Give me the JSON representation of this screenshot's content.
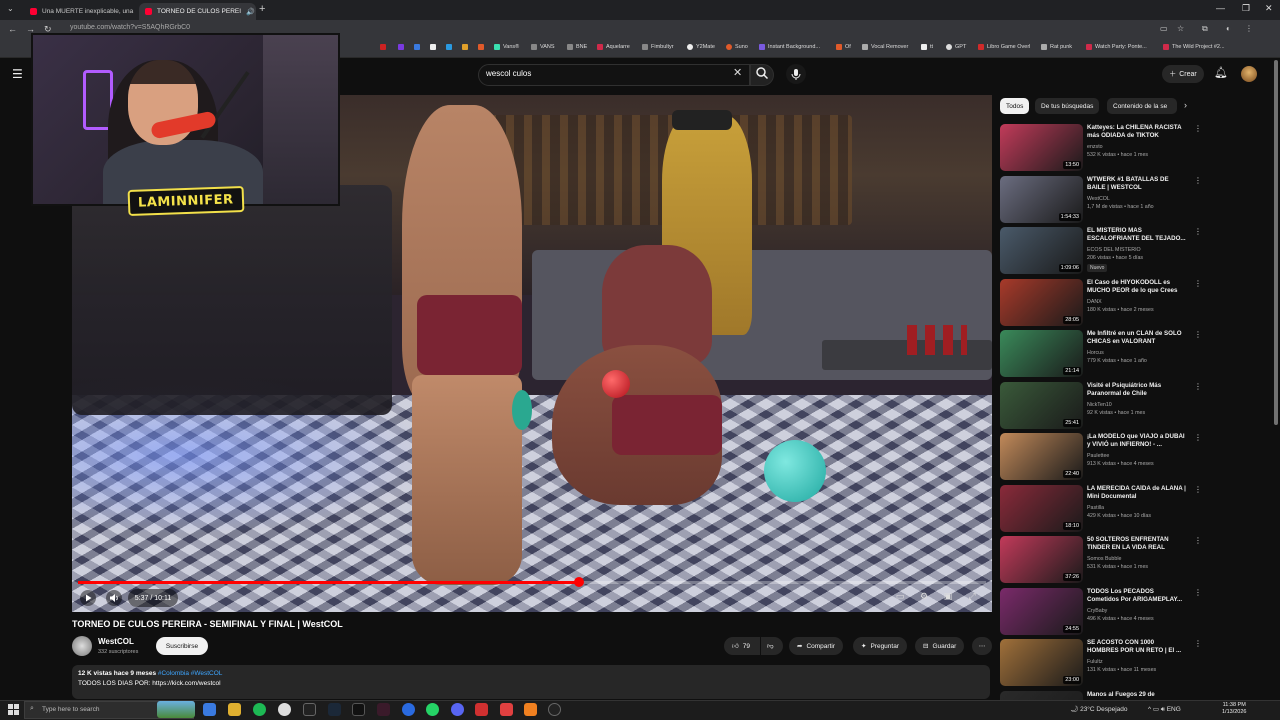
{
  "browser": {
    "tabs": [
      {
        "title": "Una MUERTE inexplicable, una"
      },
      {
        "title": "TORNEO DE CULOS PEREI"
      }
    ],
    "url": "youtube.com/watch?v=S5AQhRGrbC0",
    "bookmarks": [
      "Vans®",
      "VANS",
      "BNE",
      "Aquelarre",
      "Fimbultyr",
      "Y2Mate",
      "Suno",
      "Instant Background...",
      "Of",
      "Vocal Remover",
      "tt",
      "GPT",
      "Libro Game Overl",
      "Rat punk",
      "Watch Party: Ponte...",
      "The Wild Project #2..."
    ]
  },
  "youtube": {
    "search_query": "wescol culos",
    "create_label": "Crear"
  },
  "overlay": {
    "streamer_name": "LAMINNIFER"
  },
  "player": {
    "time": "5:37 / 10:11",
    "progress": 0.552
  },
  "video": {
    "title": "TORNEO DE CULOS PEREIRA - SEMIFINAL Y FINAL | WestCOL",
    "channel": "WestCOL",
    "subscribers": "332 suscriptores",
    "subscribe_label": "Suscribirse",
    "likes": "79",
    "share_label": "Compartir",
    "ask_label": "Preguntar",
    "save_label": "Guardar",
    "views_date": "12 K vistas  hace 9 meses",
    "tags": "#Colombia #WestCOL",
    "description_line": "TODOS LOS DIAS POR: https://kick.com/westcol"
  },
  "sidebar": {
    "chips": [
      "Todos",
      "De tus búsquedas",
      "Contenido de la se"
    ],
    "recommendations": [
      {
        "title": "Katteyes: La CHILENA RACISTA más ODIADA de TIKTOK",
        "channel": "enzsto",
        "meta": "532 K vistas • hace 1 mes",
        "duration": "13:50",
        "color": "#c23b5a"
      },
      {
        "title": "WTWERK #1 BATALLAS DE BAILE | WESTCOL",
        "channel": "WestCOL",
        "meta": "1,7 M de vistas • hace 1 año",
        "duration": "1:54:33",
        "color": "#6b6d80"
      },
      {
        "title": "EL MISTERIO MAS ESCALOFRIANTE DEL TEJADO...",
        "channel": "ECOS DEL MISTERIO",
        "meta": "206 vistas • hace 5 días",
        "duration": "1:09:06",
        "badge": "Nuevo",
        "color": "#4a5a6a"
      },
      {
        "title": "El Caso de HIYOKODOLL es MUCHO PEOR de lo que Crees",
        "channel": "DANX",
        "meta": "180 K vistas • hace 2 meses",
        "duration": "28:05",
        "color": "#a83a2a"
      },
      {
        "title": "Me Infiltré en un CLAN de SOLO CHICAS en VALORANT",
        "channel": "Horcus",
        "meta": "779 K vistas • hace 1 año",
        "duration": "21:14",
        "color": "#3a8a5a"
      },
      {
        "title": "Visité el Psiquiátrico Más Paranormal de Chile",
        "channel": "NickTen10",
        "meta": "92 K vistas • hace 1 mes",
        "duration": "25:41",
        "color": "#3a5a3a"
      },
      {
        "title": "¡La MODELO que VIAJÓ a DUBÁI y VIVIÓ un INFIERNO! - ...",
        "channel": "Paulettee",
        "meta": "913 K vistas • hace 4 meses",
        "duration": "22:40",
        "color": "#c28a5a"
      },
      {
        "title": "LA MERECIDA CAÍDA de ALANA | Mini Documental",
        "channel": "Pastilla",
        "meta": "429 K vistas • hace 10 días",
        "duration": "18:10",
        "color": "#8a2a3a"
      },
      {
        "title": "50 SOLTEROS ENFRENTAN TINDER EN LA VIDA REAL",
        "channel": "Somos Bubble",
        "meta": "531 K vistas • hace 1 mes",
        "duration": "37:26",
        "color": "#c23a5a"
      },
      {
        "title": "TODOS Los PECADOS Cometidos Por ARIGAMEPLAY...",
        "channel": "CryBaby",
        "meta": "496 K vistas • hace 4 meses",
        "duration": "24:55",
        "color": "#7a2a6a"
      },
      {
        "title": "SE ACOSTO CON 1000 HOMBRES POR UN RETO | El ...",
        "channel": "Fulultz",
        "meta": "131 K vistas • hace 11 meses",
        "duration": "23:00",
        "color": "#a0703a"
      },
      {
        "title": "Manos al Fuegos 29 de",
        "channel": "",
        "meta": "",
        "duration": "",
        "color": "#2a2a2a"
      }
    ]
  },
  "taskbar": {
    "search_placeholder": "Type here to search",
    "weather": "23°C  Despejado",
    "language": "ENG",
    "time": "11:38 PM",
    "date": "1/13/2026"
  }
}
